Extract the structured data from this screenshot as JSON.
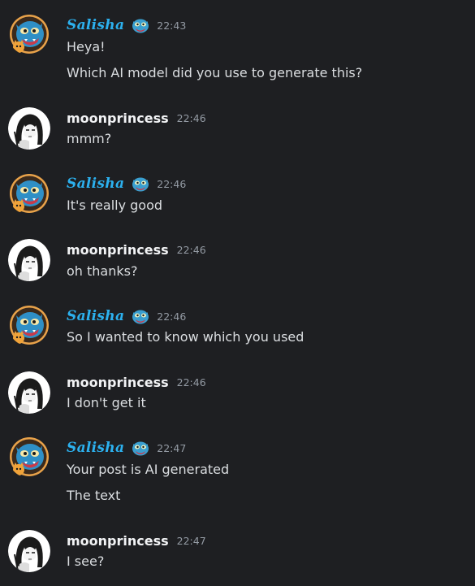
{
  "messages": [
    {
      "author": "Salisha",
      "time": "22:43",
      "lines": [
        "Heya!",
        "Which AI model did you use to generate this?"
      ]
    },
    {
      "author": "moonprincess",
      "time": "22:46",
      "lines": [
        "mmm?"
      ]
    },
    {
      "author": "Salisha",
      "time": "22:46",
      "lines": [
        "It's really good"
      ]
    },
    {
      "author": "moonprincess",
      "time": "22:46",
      "lines": [
        "oh thanks?"
      ]
    },
    {
      "author": "Salisha",
      "time": "22:46",
      "lines": [
        "So I wanted to know which you used"
      ]
    },
    {
      "author": "moonprincess",
      "time": "22:46",
      "lines": [
        "I don't get it"
      ]
    },
    {
      "author": "Salisha",
      "time": "22:47",
      "lines": [
        "Your post is AI generated",
        "The text"
      ]
    },
    {
      "author": "moonprincess",
      "time": "22:47",
      "lines": [
        "I see?"
      ]
    }
  ],
  "colors": {
    "background": "#1e1f22",
    "salisha_name": "#2cb1ef",
    "moonprincess_name": "#f2f3f5",
    "message_text": "#dbdee1",
    "timestamp": "#949ba4"
  },
  "icons": {
    "salisha_avatar": "blue-creature-avatar-icon",
    "salisha_badge": "blue-creature-badge-icon",
    "moonprincess_avatar": "anime-girl-avatar-icon"
  }
}
